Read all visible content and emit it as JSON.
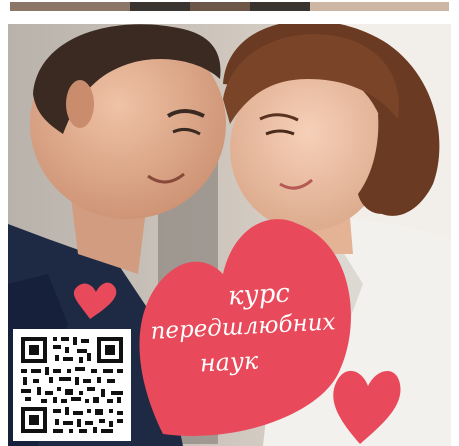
{
  "promo": {
    "line1": "курс",
    "line2": "передшлюбних",
    "line3": "наук"
  },
  "colors": {
    "heart": "#e84a5b",
    "hair_man": "#3a2a22",
    "hair_woman": "#6b3a22",
    "skin": "#e8b59a",
    "shirt_man": "#1e2a44",
    "shirt_woman": "#f3f1ee",
    "background": "#d8d2cb"
  },
  "qr": {
    "icon": "qr-code-icon"
  }
}
